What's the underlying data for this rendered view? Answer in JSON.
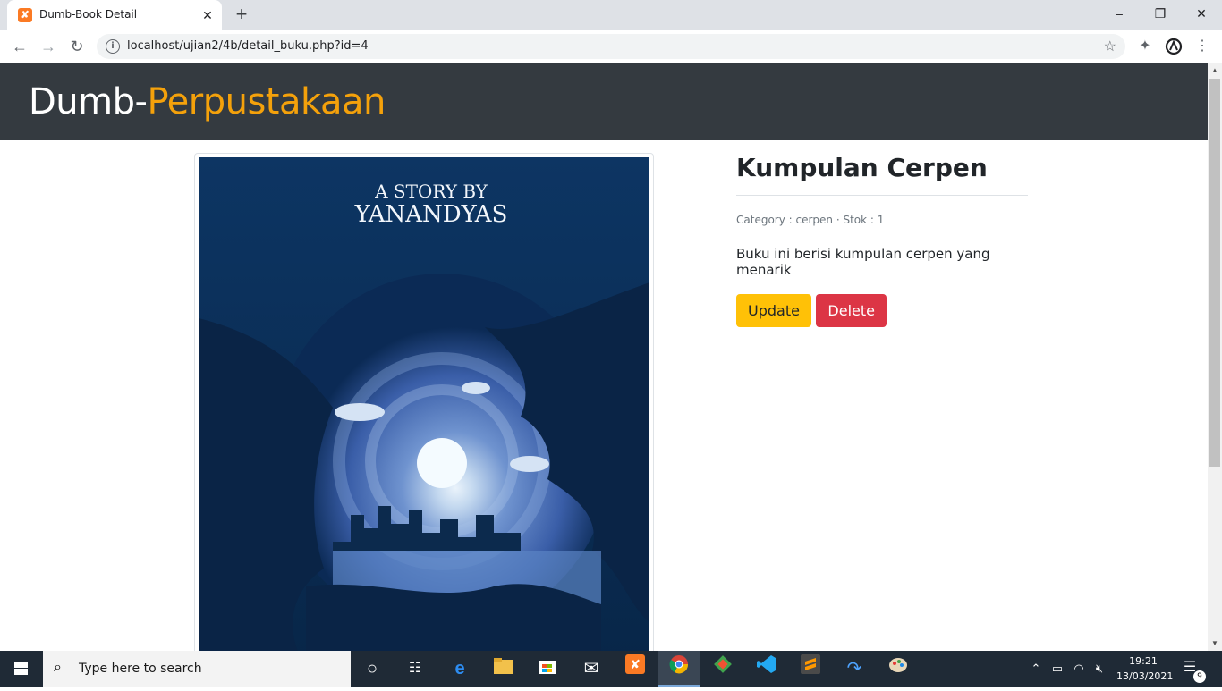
{
  "browser": {
    "tab_title": "Dumb-Book Detail",
    "tab_favicon": "xampp-icon",
    "url": "localhost/ujian2/4b/detail_buku.php?id=4"
  },
  "page": {
    "brand_prefix": "Dumb-",
    "brand_accent": "Perpustakaan",
    "brand_accent_color": "#f4a10b",
    "book": {
      "title": "Kumpulan Cerpen",
      "meta": "Category : cerpen · Stok : 1",
      "description": "Buku ini berisi kumpulan cerpen yang menarik",
      "cover_line1": "A STORY BY",
      "cover_line2": "YANANDYAS"
    },
    "buttons": {
      "update": "Update",
      "delete": "Delete"
    }
  },
  "taskbar": {
    "search_placeholder": "Type here to search",
    "time": "19:21",
    "date": "13/03/2021",
    "notification_count": "9"
  }
}
